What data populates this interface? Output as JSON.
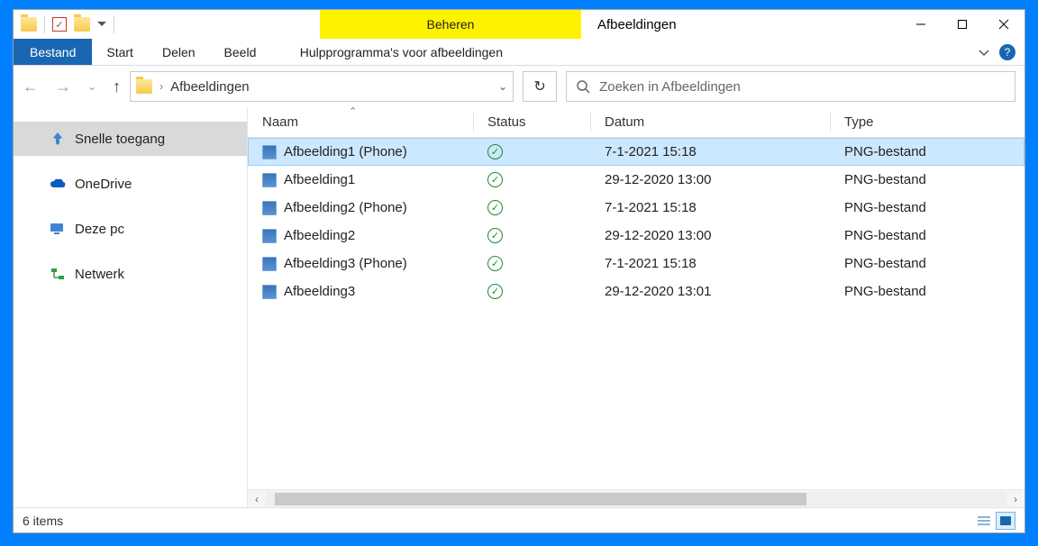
{
  "title": {
    "context_tab": "Beheren",
    "window_title": "Afbeeldingen"
  },
  "ribbon": {
    "file": "Bestand",
    "tabs": [
      "Start",
      "Delen",
      "Beeld"
    ],
    "context": "Hulpprogramma's voor afbeeldingen"
  },
  "address": {
    "crumb": "Afbeeldingen"
  },
  "search": {
    "placeholder": "Zoeken in Afbeeldingen"
  },
  "sidebar": {
    "items": [
      {
        "label": "Snelle toegang"
      },
      {
        "label": "OneDrive"
      },
      {
        "label": "Deze pc"
      },
      {
        "label": "Netwerk"
      }
    ]
  },
  "columns": {
    "name": "Naam",
    "status": "Status",
    "date": "Datum",
    "type": "Type"
  },
  "files": [
    {
      "name": "Afbeelding1 (Phone)",
      "date": "7-1-2021 15:18",
      "type": "PNG-bestand",
      "selected": true
    },
    {
      "name": "Afbeelding1",
      "date": "29-12-2020 13:00",
      "type": "PNG-bestand",
      "selected": false
    },
    {
      "name": "Afbeelding2 (Phone)",
      "date": "7-1-2021 15:18",
      "type": "PNG-bestand",
      "selected": false
    },
    {
      "name": "Afbeelding2",
      "date": "29-12-2020 13:00",
      "type": "PNG-bestand",
      "selected": false
    },
    {
      "name": "Afbeelding3 (Phone)",
      "date": "7-1-2021 15:18",
      "type": "PNG-bestand",
      "selected": false
    },
    {
      "name": "Afbeelding3",
      "date": "29-12-2020 13:01",
      "type": "PNG-bestand",
      "selected": false
    }
  ],
  "statusbar": {
    "count": "6 items"
  }
}
